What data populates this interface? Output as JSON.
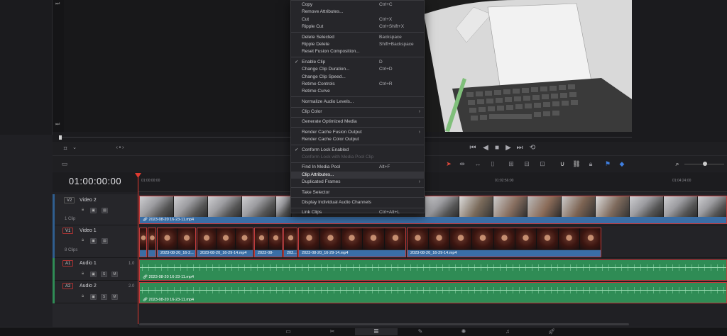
{
  "viewer": {
    "timecode": "01:00:00:00"
  },
  "ruler": {
    "labels": [
      "01:00:00:00",
      "01:02:56:00",
      "01:04:24:00"
    ]
  },
  "context_menu": {
    "items": [
      {
        "label": "Copy",
        "shortcut": "Ctrl+C"
      },
      {
        "label": "Remove Attributes..."
      },
      {
        "label": "Cut",
        "shortcut": "Ctrl+X"
      },
      {
        "label": "Ripple Cut",
        "shortcut": "Ctrl+Shift+X"
      },
      {
        "sep": true
      },
      {
        "label": "Delete Selected",
        "shortcut": "Backspace"
      },
      {
        "label": "Ripple Delete",
        "shortcut": "Shift+Backspace"
      },
      {
        "label": "Reset Fusion Composition..."
      },
      {
        "sep": true
      },
      {
        "label": "Enable Clip",
        "shortcut": "D",
        "checked": true
      },
      {
        "label": "Change Clip Duration...",
        "shortcut": "Ctrl+D"
      },
      {
        "label": "Change Clip Speed..."
      },
      {
        "label": "Retime Controls",
        "shortcut": "Ctrl+R"
      },
      {
        "label": "Retime Curve"
      },
      {
        "sep": true
      },
      {
        "label": "Normalize Audio Levels..."
      },
      {
        "sep": true
      },
      {
        "label": "Clip Color",
        "submenu": true
      },
      {
        "sep": true
      },
      {
        "label": "Generate Optimized Media"
      },
      {
        "sep": true
      },
      {
        "label": "Render Cache Fusion Output",
        "submenu": true
      },
      {
        "label": "Render Cache Color Output"
      },
      {
        "sep": true
      },
      {
        "label": "Conform Lock Enabled",
        "checked": true
      },
      {
        "label": "Conform Lock with Media Pool Clip",
        "disabled": true
      },
      {
        "sep": true
      },
      {
        "label": "Find In Media Pool",
        "shortcut": "Alt+F"
      },
      {
        "label": "Clip Attributes...",
        "highlighted": true
      },
      {
        "label": "Duplicated Frames",
        "submenu": true
      },
      {
        "sep": true
      },
      {
        "label": "Take Selector"
      },
      {
        "sep": true
      },
      {
        "label": "Display Individual Audio Channels"
      },
      {
        "sep": true
      },
      {
        "label": "Link Clips",
        "shortcut": "Ctrl+Alt+L"
      }
    ]
  },
  "tracks": {
    "v2": {
      "tag": "V2",
      "name": "Video 2",
      "count": "1 Clip",
      "clip": "2023-08-20 16-23-11.mp4"
    },
    "v1": {
      "tag": "V1",
      "name": "Video 1",
      "count": "8 Clips",
      "clips": [
        "2023-08-20_16-2...",
        "2023-08-20_16-29-14.mp4",
        "2023-08-20_...",
        "202...",
        "2023-08-20_16-29-14.mp4",
        "2023-08-20_16-29-14.mp4"
      ]
    },
    "a1": {
      "tag": "A1",
      "name": "Audio 1",
      "level": "1.0",
      "clip": "2023-08-20 16-23-11.mp4"
    },
    "a2": {
      "tag": "A2",
      "name": "Audio 2",
      "level": "2.0",
      "clip": "2023-08-20 16-23-11.mp4"
    }
  },
  "track_buttons": {
    "solo": "S",
    "mute": "M"
  },
  "colors": {
    "accent_red": "#e03a30",
    "clip_blue": "#3a6ea6",
    "audio_green": "#2f8c55"
  }
}
